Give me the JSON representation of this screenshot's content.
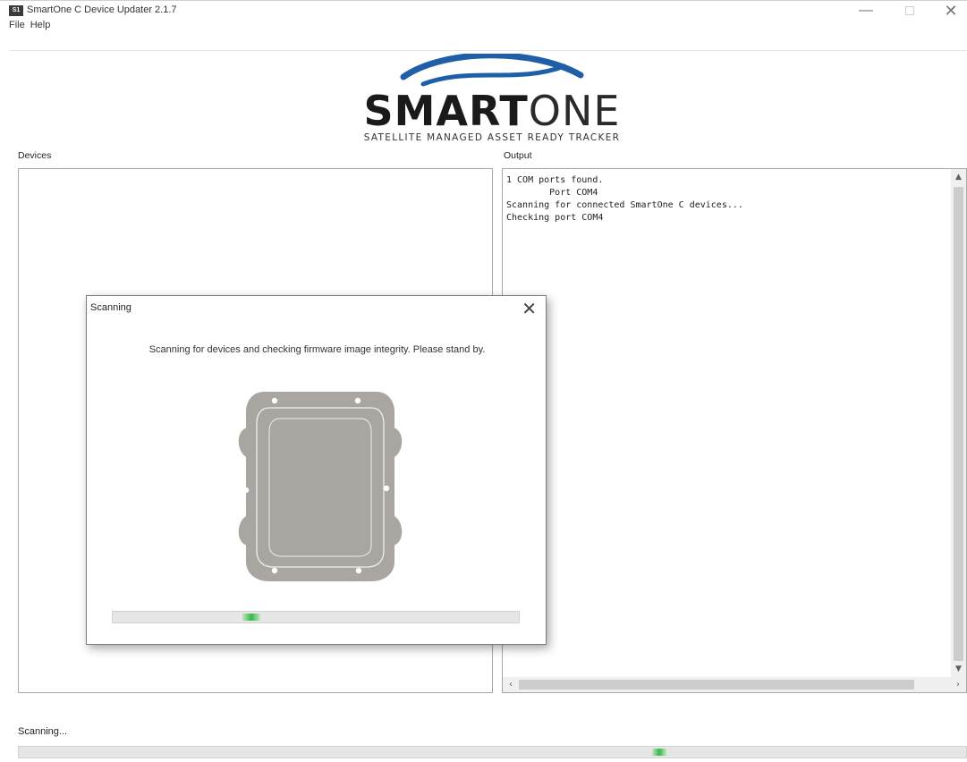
{
  "window": {
    "title": "SmartOne C Device Updater 2.1.7",
    "icon_label": "S1",
    "controls": [
      "minimize-icon",
      "maximize-icon",
      "close-icon"
    ]
  },
  "menu": {
    "items": [
      {
        "label": "File"
      },
      {
        "label": "Help"
      }
    ]
  },
  "logo": {
    "word_bold": "SMART",
    "word_light": "ONE",
    "tagline": "SATELLITE MANAGED ASSET READY TRACKER",
    "swoosh_color": "#1f5fa8"
  },
  "devices": {
    "label": "Devices"
  },
  "output": {
    "label": "Output",
    "lines": "1 COM ports found.\n        Port COM4\nScanning for connected SmartOne C devices...\nChecking port COM4"
  },
  "status": {
    "text": "Scanning..."
  },
  "dialog": {
    "title": "Scanning",
    "close_glyph": "✕",
    "message": "Scanning for devices and checking firmware image integrity. Please stand by.",
    "device_color": "#a9a6a2"
  },
  "colors": {
    "progress_green": "#39b54a",
    "progress_track": "#e6e6e6"
  }
}
